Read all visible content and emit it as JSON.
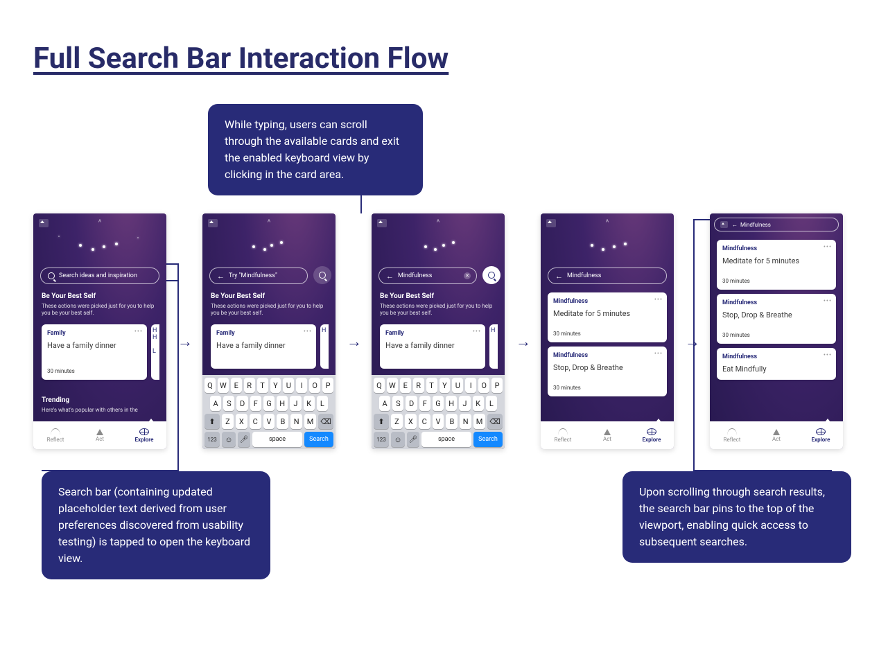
{
  "title": "Full Search Bar Interaction Flow",
  "annotations": {
    "a1": "While typing, users can scroll through the available cards and exit the enabled keyboard view by clicking in the card area.",
    "a2": "Search bar (containing updated placeholder text derived from user preferences discovered from usability testing) is tapped to open the keyboard view.",
    "a3": "Upon scrolling through search results, the search bar pins to the top of the viewport, enabling quick access to subsequent searches."
  },
  "tabs": {
    "reflect": "Reflect",
    "act": "Act",
    "explore": "Explore"
  },
  "headers": {
    "best_title": "Be Your Best Self",
    "best_sub": "These actions were picked just for you to help you be your best self.",
    "trending_title": "Trending",
    "trending_sub": "Here's what's popular with others in the"
  },
  "search": {
    "placeholder_initial": "Search ideas and inspiration",
    "placeholder_typing": "Try \"Mindfulness\"",
    "value_filled": "Mindfulness",
    "kbd_search": "Search",
    "kbd_space": "space",
    "kbd_123": "123"
  },
  "card_family": {
    "tag": "Family",
    "action": "Have a family dinner",
    "duration": "30 minutes"
  },
  "results": [
    {
      "tag": "Mindfulness",
      "action": "Meditate for 5 minutes",
      "duration": "30 minutes"
    },
    {
      "tag": "Mindfulness",
      "action": "Stop, Drop & Breathe",
      "duration": "30 minutes"
    },
    {
      "tag": "Mindfulness",
      "action": "Eat Mindfully",
      "duration": ""
    }
  ],
  "keyboard_rows": {
    "r1": [
      "Q",
      "W",
      "E",
      "R",
      "T",
      "Y",
      "U",
      "I",
      "O",
      "P"
    ],
    "r2": [
      "A",
      "S",
      "D",
      "F",
      "G",
      "H",
      "J",
      "K",
      "L"
    ],
    "r3": [
      "Z",
      "X",
      "C",
      "V",
      "B",
      "N",
      "M"
    ]
  }
}
